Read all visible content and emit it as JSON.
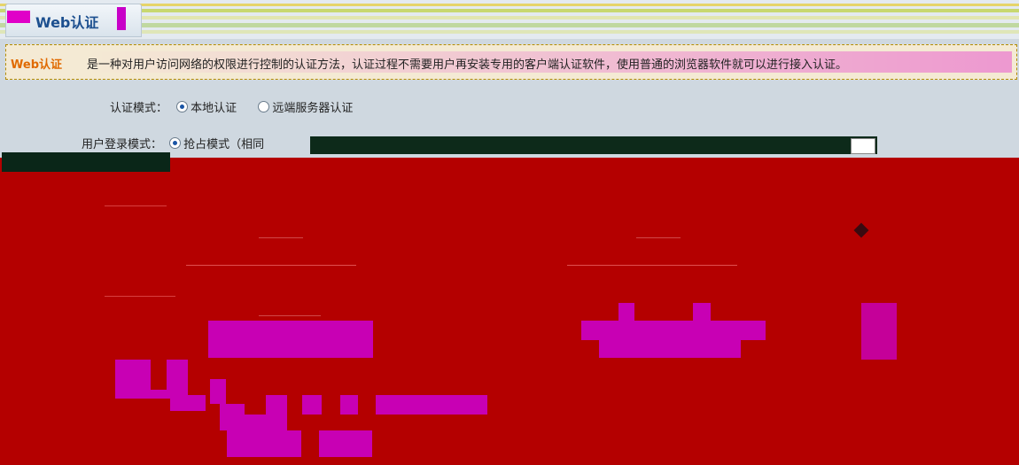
{
  "header": {
    "title": "Web认证"
  },
  "info": {
    "keyword": "Web认证",
    "description": "是一种对用户访问网络的权限进行控制的认证方法，认证过程不需要用户再安装专用的客户端认证软件，使用普通的浏览器软件就可以进行接入认证。"
  },
  "form": {
    "auth_mode": {
      "label": "认证模式：",
      "options": [
        "本地认证",
        "远端服务器认证"
      ],
      "selected": 0
    },
    "login_mode": {
      "label": "用户登录模式：",
      "option": "抢占模式（相同"
    }
  },
  "colors": {
    "accent": "#e06a00",
    "content_bg": "#b40000",
    "glitch": "#c800b4"
  }
}
